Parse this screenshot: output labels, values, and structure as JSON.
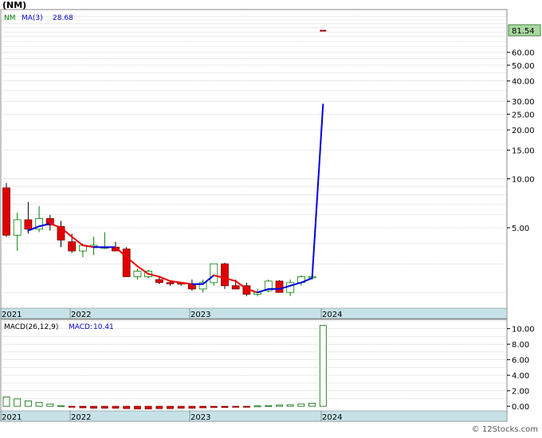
{
  "chart_data": [
    {
      "type": "candlestick",
      "title": "(NM)",
      "legend": [
        {
          "name": "NM",
          "color": "#008000"
        },
        {
          "name": "MA(3)",
          "value": "28.68",
          "color": "#0000cc"
        }
      ],
      "last_price_label": "81.54",
      "y_scale": "log",
      "ylim": [
        1.6,
        110
      ],
      "y_ticks": [
        "60.00",
        "50.00",
        "40.00",
        "30.00",
        "25.00",
        "20.00",
        "15.00",
        "10.00",
        "5.00"
      ],
      "y_tick_values": [
        60,
        50,
        40,
        30,
        25,
        20,
        15,
        10,
        5
      ],
      "x_labels": [
        "2021",
        "2022",
        "2023",
        "2024"
      ],
      "x_label_positions": [
        1,
        13,
        31,
        46
      ],
      "candles": [
        {
          "o": 8.8,
          "h": 9.4,
          "l": 4.4,
          "c": 4.5,
          "up": false
        },
        {
          "o": 4.5,
          "h": 6.2,
          "l": 3.6,
          "c": 5.6,
          "up": true
        },
        {
          "o": 5.6,
          "h": 7.2,
          "l": 4.6,
          "c": 4.9,
          "up": false
        },
        {
          "o": 4.9,
          "h": 6.8,
          "l": 4.7,
          "c": 5.7,
          "up": true
        },
        {
          "o": 5.7,
          "h": 6.0,
          "l": 4.8,
          "c": 5.2,
          "up": false
        },
        {
          "o": 5.1,
          "h": 5.5,
          "l": 3.8,
          "c": 4.2,
          "up": false
        },
        {
          "o": 4.1,
          "h": 4.6,
          "l": 3.5,
          "c": 3.6,
          "up": false
        },
        {
          "o": 3.6,
          "h": 4.0,
          "l": 3.3,
          "c": 3.9,
          "up": true
        },
        {
          "o": 3.9,
          "h": 4.4,
          "l": 3.4,
          "c": 3.9,
          "up": true
        },
        {
          "o": 3.8,
          "h": 4.7,
          "l": 3.7,
          "c": 3.8,
          "up": true
        },
        {
          "o": 3.8,
          "h": 4.1,
          "l": 3.6,
          "c": 3.6,
          "up": false
        },
        {
          "o": 3.7,
          "h": 3.8,
          "l": 2.5,
          "c": 2.5,
          "up": false
        },
        {
          "o": 2.5,
          "h": 2.8,
          "l": 2.4,
          "c": 2.7,
          "up": true
        },
        {
          "o": 2.7,
          "h": 2.75,
          "l": 2.45,
          "c": 2.5,
          "up": true
        },
        {
          "o": 2.4,
          "h": 2.5,
          "l": 2.25,
          "c": 2.3,
          "up": false
        },
        {
          "o": 2.3,
          "h": 2.35,
          "l": 2.2,
          "c": 2.3,
          "up": false
        },
        {
          "o": 2.3,
          "h": 2.32,
          "l": 2.2,
          "c": 2.25,
          "up": false
        },
        {
          "o": 2.25,
          "h": 2.4,
          "l": 2.05,
          "c": 2.1,
          "up": false
        },
        {
          "o": 2.1,
          "h": 2.4,
          "l": 2.0,
          "c": 2.3,
          "up": true
        },
        {
          "o": 2.3,
          "h": 3.0,
          "l": 2.2,
          "c": 3.0,
          "up": true
        },
        {
          "o": 3.0,
          "h": 3.05,
          "l": 2.1,
          "c": 2.2,
          "up": false
        },
        {
          "o": 2.2,
          "h": 2.4,
          "l": 2.1,
          "c": 2.1,
          "up": false
        },
        {
          "o": 2.2,
          "h": 2.3,
          "l": 1.9,
          "c": 1.95,
          "up": false
        },
        {
          "o": 1.95,
          "h": 2.1,
          "l": 1.9,
          "c": 2.0,
          "up": true
        },
        {
          "o": 2.05,
          "h": 2.4,
          "l": 2.0,
          "c": 2.35,
          "up": true
        },
        {
          "o": 2.35,
          "h": 2.38,
          "l": 2.0,
          "c": 2.0,
          "up": false
        },
        {
          "o": 2.0,
          "h": 2.4,
          "l": 1.9,
          "c": 2.3,
          "up": true
        },
        {
          "o": 2.3,
          "h": 2.55,
          "l": 2.2,
          "c": 2.5,
          "up": true
        },
        {
          "o": 2.5,
          "h": 2.6,
          "l": 2.4,
          "c": 2.5,
          "up": true
        },
        {
          "o": 81.54,
          "h": 81.54,
          "l": 81.54,
          "c": 81.54,
          "up": false
        }
      ],
      "ma3": [
        null,
        null,
        4.8,
        5.1,
        5.3,
        5.0,
        4.4,
        3.9,
        3.8,
        3.8,
        3.8,
        3.3,
        2.9,
        2.6,
        2.5,
        2.35,
        2.3,
        2.25,
        2.25,
        2.55,
        2.45,
        2.35,
        2.1,
        2.0,
        2.1,
        2.1,
        2.2,
        2.3,
        2.45,
        28.68
      ]
    },
    {
      "type": "bar",
      "title": "MACD(26,12,9)",
      "legend": [
        {
          "name": "MACD(26,12,9)",
          "color": "#000000"
        },
        {
          "name": "MACD:",
          "value": "10.41",
          "color": "#0000cc"
        }
      ],
      "ylim": [
        -0.6,
        11.2
      ],
      "y_ticks": [
        "10.00",
        "8.00",
        "6.00",
        "4.00",
        "2.00",
        "0.00"
      ],
      "y_tick_values": [
        10,
        8,
        6,
        4,
        2,
        0
      ],
      "x_labels": [
        "2021",
        "2022",
        "2023",
        "2024"
      ],
      "values": [
        1.2,
        0.95,
        0.7,
        0.5,
        0.3,
        0.1,
        -0.1,
        -0.2,
        -0.25,
        -0.25,
        -0.25,
        -0.3,
        -0.35,
        -0.35,
        -0.3,
        -0.3,
        -0.25,
        -0.25,
        -0.2,
        -0.15,
        -0.15,
        -0.1,
        -0.05,
        0.05,
        0.1,
        0.15,
        0.2,
        0.3,
        0.4,
        10.41
      ]
    }
  ],
  "watermark": "© 12Stocks.com"
}
